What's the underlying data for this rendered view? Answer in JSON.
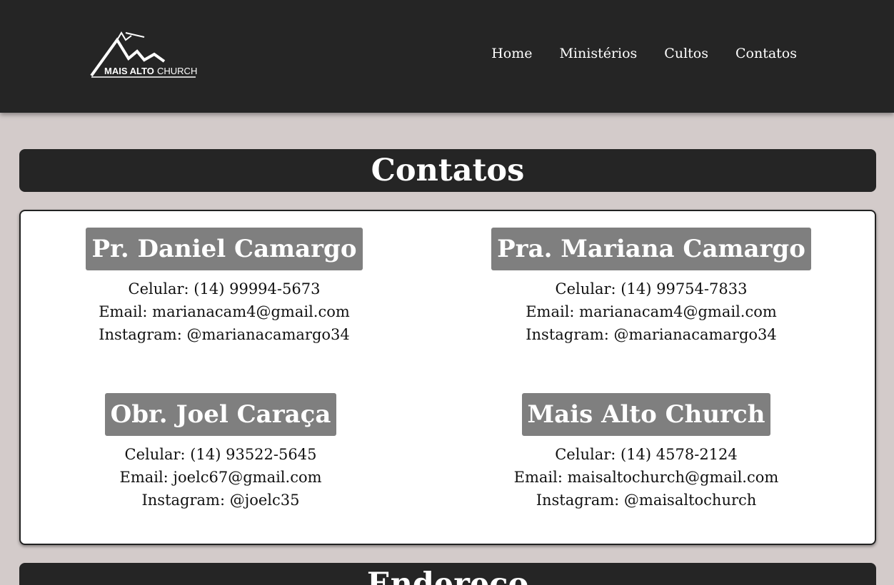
{
  "header": {
    "logo_text_main": "MAIS ALTO",
    "logo_text_sub": "CHURCH",
    "nav": [
      "Home",
      "Ministérios",
      "Cultos",
      "Contatos"
    ]
  },
  "contacts_section": {
    "title": "Contatos",
    "cards": [
      {
        "name": "Pr. Daniel Camargo",
        "phone": "Celular: (14) 99994-5673",
        "email": "Email: marianacam4@gmail.com",
        "instagram": "Instagram: @marianacamargo34"
      },
      {
        "name": "Pra. Mariana Camargo",
        "phone": "Celular: (14) 99754-7833",
        "email": "Email: marianacam4@gmail.com",
        "instagram": "Instagram: @marianacamargo34"
      },
      {
        "name": "Obr. Joel Caraça",
        "phone": "Celular: (14) 93522-5645",
        "email": "Email: joelc67@gmail.com",
        "instagram": "Instagram: @joelc35"
      },
      {
        "name": "Mais Alto Church",
        "phone": "Celular: (14) 4578-2124",
        "email": "Email: maisaltochurch@gmail.com",
        "instagram": "Instagram: @maisaltochurch"
      }
    ]
  },
  "address_section": {
    "title": "Endereço"
  },
  "colors": {
    "header_bg": "#252525",
    "page_bg": "#d3cbca",
    "name_badge_bg": "#7f7f7f"
  }
}
